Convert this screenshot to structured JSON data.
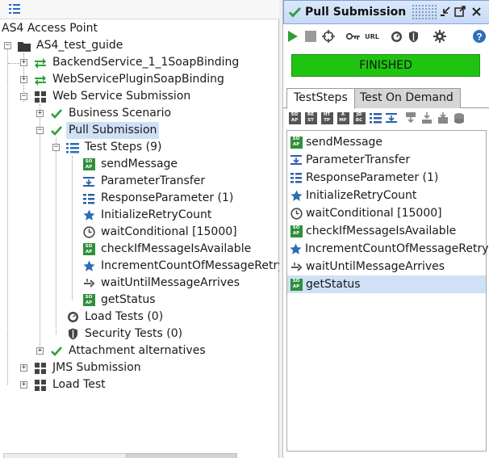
{
  "tree": {
    "root": "AS4 Access Point",
    "project": "AS4_test_guide",
    "interfaces": [
      "BackendService_1_1SoapBinding",
      "WebServicePluginSoapBinding"
    ],
    "suite": "Web Service Submission",
    "cases": {
      "business": "Business Scenario",
      "pull": "Pull Submission",
      "attach": "Attachment alternatives"
    },
    "test_steps_label": "Test Steps (9)",
    "steps": [
      "sendMessage",
      "ParameterTransfer",
      "ResponseParameter (1)",
      "InitializeRetryCount",
      "waitConditional [15000]",
      "checkIfMessageIsAvailable",
      "IncrementCountOfMessageRetry",
      "waitUntilMessageArrives",
      "getStatus"
    ],
    "load_tests": "Load Tests (0)",
    "security_tests": "Security Tests (0)",
    "other_suites": [
      "JMS Submission",
      "Load Test"
    ]
  },
  "panel": {
    "title": "Pull Submission",
    "status": "FINISHED",
    "status_color": "#1fc410",
    "tabs": [
      "TestSteps",
      "Test On Demand"
    ],
    "active_tab": "TestSteps",
    "url_label": "URL",
    "steps_toolbar": [
      "SO AP",
      "RE ST",
      "HT TP",
      "A MF",
      "JD BC"
    ],
    "steps": [
      "sendMessage",
      "ParameterTransfer",
      "ResponseParameter (1)",
      "InitializeRetryCount",
      "waitConditional [15000]",
      "checkIfMessageIsAvailable",
      "IncrementCountOfMessageRetry",
      "waitUntilMessageArrives",
      "getStatus"
    ],
    "selected_step": "getStatus"
  },
  "colors": {
    "accent_green": "#2f9e3a",
    "selection": "#cfe0f7",
    "title_bg": "#c7daf5"
  },
  "icons": {
    "steps": [
      "soap-request-icon",
      "property-transfer-icon",
      "properties-icon",
      "star-icon",
      "clock-icon",
      "soap-request-icon",
      "star-icon",
      "groovy-script-icon",
      "soap-request-icon"
    ]
  }
}
